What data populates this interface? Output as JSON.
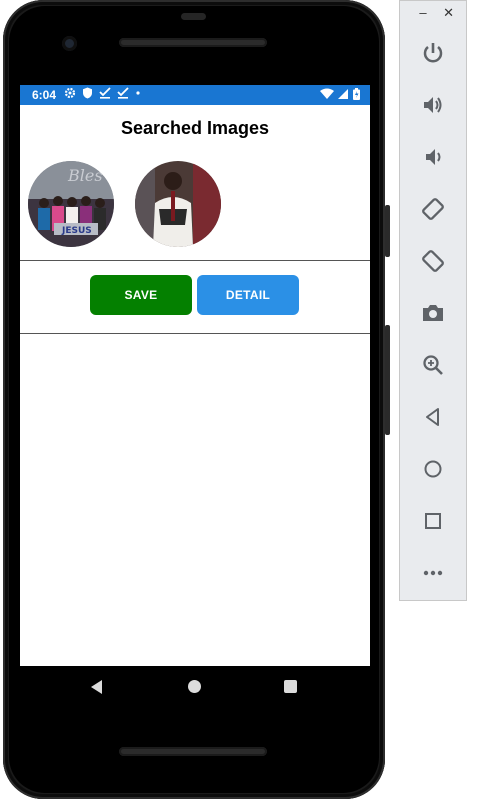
{
  "status_bar": {
    "time": "6:04"
  },
  "app": {
    "title": "Searched Images",
    "thumbnails": [
      {
        "name": "image-thumbnail-1"
      },
      {
        "name": "image-thumbnail-2"
      }
    ],
    "buttons": {
      "save": "SAVE",
      "detail": "DETAIL"
    }
  },
  "colors": {
    "status_bar": "#1976d2",
    "save_button": "#048000",
    "detail_button": "#2b90e6"
  },
  "emulator_toolbar": {
    "minimize": "–",
    "close": "✕",
    "icons": [
      "power-icon",
      "volume-up-icon",
      "volume-down-icon",
      "rotate-left-icon",
      "rotate-right-icon",
      "camera-icon",
      "zoom-icon",
      "back-icon",
      "home-icon",
      "overview-icon",
      "more-icon"
    ]
  }
}
